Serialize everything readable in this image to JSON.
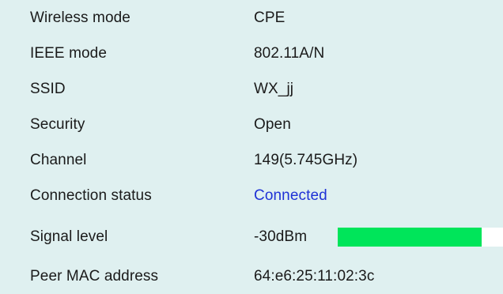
{
  "colors": {
    "background": "#dff0f0",
    "text": "#1a1a1a",
    "connected": "#1f32d6",
    "signal_fill": "#00e55a",
    "signal_track": "#ffffff"
  },
  "rows": [
    {
      "label": "Wireless mode",
      "value": "CPE"
    },
    {
      "label": "IEEE mode",
      "value": "802.11A/N"
    },
    {
      "label": "SSID",
      "value": "WX_jj"
    },
    {
      "label": "Security",
      "value": "Open"
    },
    {
      "label": "Channel",
      "value": "149(5.745GHz)"
    },
    {
      "label": "Connection status",
      "value": "Connected"
    },
    {
      "label": "Signal level",
      "value": "-30dBm"
    },
    {
      "label": "Peer MAC address",
      "value": "64:e6:25:11:02:3c"
    }
  ],
  "signal": {
    "fill_fraction": 0.87
  }
}
